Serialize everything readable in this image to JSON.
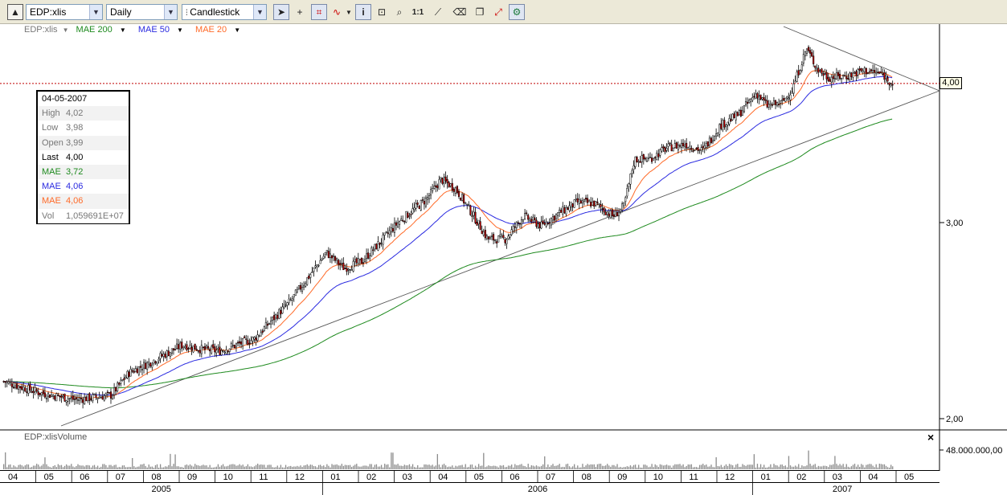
{
  "toolbar": {
    "symbol": "EDP:xlis",
    "interval": "Daily",
    "chart_type": "Candlestick",
    "icons": [
      "arrow-cursor-icon",
      "crosshair-icon",
      "grid-icon",
      "wave-icon",
      "info-icon",
      "zoom-window-icon",
      "zoom-icon",
      "zoom-1to1-label",
      "trendline-icon",
      "eraser-icon",
      "copy-icon",
      "settings-icon"
    ],
    "zoom_1to1": "1:1"
  },
  "legend": {
    "symbol": "EDP:xlis",
    "items": [
      {
        "label": "MAE 200",
        "color": "#1e8a1e"
      },
      {
        "label": "MAE 50",
        "color": "#2a2ae0"
      },
      {
        "label": "MAE 20",
        "color": "#ff6a28"
      }
    ]
  },
  "infobox": {
    "date": "04-05-2007",
    "rows": [
      {
        "k": "High",
        "v": "4,02",
        "color": "#777777"
      },
      {
        "k": "Low",
        "v": "3,98",
        "color": "#777777"
      },
      {
        "k": "Open",
        "v": "3,99",
        "color": "#777777"
      },
      {
        "k": "Last",
        "v": "4,00",
        "color": "#000000"
      },
      {
        "k": "MAE",
        "v": "3,72",
        "color": "#1e8a1e"
      },
      {
        "k": "MAE",
        "v": "4,06",
        "color": "#2a2ae0"
      },
      {
        "k": "MAE",
        "v": "4,06",
        "color": "#ff6a28"
      },
      {
        "k": "Vol",
        "v": "1,059691E+07",
        "color": "#777777"
      }
    ]
  },
  "price_tag": "4,00",
  "volume_label": "EDP:xlisVolume",
  "volume_close": "×",
  "chart_data": {
    "type": "candlestick",
    "y_axis": {
      "scale": "log",
      "range": [
        1.9,
        4.6
      ],
      "ticks": [
        "2,00",
        "3,00"
      ],
      "current_price": 4.0
    },
    "volume_axis": {
      "ticks": [
        "48.000.000,00"
      ]
    },
    "x_axis": {
      "months": [
        "04",
        "05",
        "06",
        "07",
        "08",
        "09",
        "10",
        "11",
        "12",
        "01",
        "02",
        "03",
        "04",
        "05",
        "06",
        "07",
        "08",
        "09",
        "10",
        "11",
        "12",
        "01",
        "02",
        "03",
        "04",
        "05"
      ],
      "years": [
        "2005",
        "2006",
        "2007"
      ]
    },
    "price_anchors": [
      {
        "month": 0.0,
        "close": 2.16
      },
      {
        "month": 1.0,
        "close": 2.11
      },
      {
        "month": 2.0,
        "close": 2.08
      },
      {
        "month": 3.0,
        "close": 2.1
      },
      {
        "month": 3.5,
        "close": 2.2
      },
      {
        "month": 4.0,
        "close": 2.24
      },
      {
        "month": 5.0,
        "close": 2.33
      },
      {
        "month": 5.5,
        "close": 2.31
      },
      {
        "month": 6.0,
        "close": 2.3
      },
      {
        "month": 7.0,
        "close": 2.36
      },
      {
        "month": 8.0,
        "close": 2.55
      },
      {
        "month": 8.5,
        "close": 2.68
      },
      {
        "month": 9.0,
        "close": 2.82
      },
      {
        "month": 9.5,
        "close": 2.73
      },
      {
        "month": 10.0,
        "close": 2.77
      },
      {
        "month": 10.5,
        "close": 2.88
      },
      {
        "month": 11.0,
        "close": 3.0
      },
      {
        "month": 11.8,
        "close": 3.15
      },
      {
        "month": 12.2,
        "close": 3.28
      },
      {
        "month": 12.6,
        "close": 3.22
      },
      {
        "month": 13.0,
        "close": 3.08
      },
      {
        "month": 13.5,
        "close": 2.9
      },
      {
        "month": 14.0,
        "close": 2.9
      },
      {
        "month": 14.5,
        "close": 3.04
      },
      {
        "month": 15.0,
        "close": 2.98
      },
      {
        "month": 15.5,
        "close": 3.06
      },
      {
        "month": 16.0,
        "close": 3.13
      },
      {
        "month": 16.5,
        "close": 3.12
      },
      {
        "month": 17.0,
        "close": 3.04
      },
      {
        "month": 17.3,
        "close": 3.1
      },
      {
        "month": 17.6,
        "close": 3.42
      },
      {
        "month": 18.0,
        "close": 3.42
      },
      {
        "month": 18.5,
        "close": 3.5
      },
      {
        "month": 19.0,
        "close": 3.53
      },
      {
        "month": 19.5,
        "close": 3.48
      },
      {
        "month": 20.0,
        "close": 3.67
      },
      {
        "month": 20.5,
        "close": 3.75
      },
      {
        "month": 21.0,
        "close": 3.92
      },
      {
        "month": 21.3,
        "close": 3.82
      },
      {
        "month": 21.7,
        "close": 3.84
      },
      {
        "month": 22.0,
        "close": 3.95
      },
      {
        "month": 22.4,
        "close": 4.3
      },
      {
        "month": 22.7,
        "close": 4.12
      },
      {
        "month": 23.0,
        "close": 4.05
      },
      {
        "month": 23.5,
        "close": 4.06
      },
      {
        "month": 24.0,
        "close": 4.11
      },
      {
        "month": 24.5,
        "close": 4.08
      },
      {
        "month": 24.8,
        "close": 4.0
      }
    ]
  }
}
